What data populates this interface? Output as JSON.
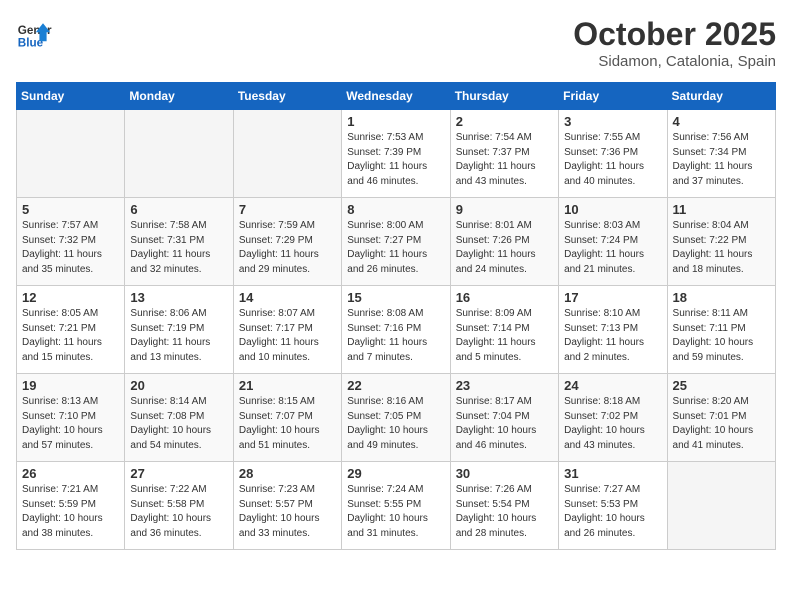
{
  "logo": {
    "line1": "General",
    "line2": "Blue"
  },
  "header": {
    "month": "October 2025",
    "location": "Sidamon, Catalonia, Spain"
  },
  "weekdays": [
    "Sunday",
    "Monday",
    "Tuesday",
    "Wednesday",
    "Thursday",
    "Friday",
    "Saturday"
  ],
  "weeks": [
    [
      {
        "day": "",
        "info": ""
      },
      {
        "day": "",
        "info": ""
      },
      {
        "day": "",
        "info": ""
      },
      {
        "day": "1",
        "info": "Sunrise: 7:53 AM\nSunset: 7:39 PM\nDaylight: 11 hours and 46 minutes."
      },
      {
        "day": "2",
        "info": "Sunrise: 7:54 AM\nSunset: 7:37 PM\nDaylight: 11 hours and 43 minutes."
      },
      {
        "day": "3",
        "info": "Sunrise: 7:55 AM\nSunset: 7:36 PM\nDaylight: 11 hours and 40 minutes."
      },
      {
        "day": "4",
        "info": "Sunrise: 7:56 AM\nSunset: 7:34 PM\nDaylight: 11 hours and 37 minutes."
      }
    ],
    [
      {
        "day": "5",
        "info": "Sunrise: 7:57 AM\nSunset: 7:32 PM\nDaylight: 11 hours and 35 minutes."
      },
      {
        "day": "6",
        "info": "Sunrise: 7:58 AM\nSunset: 7:31 PM\nDaylight: 11 hours and 32 minutes."
      },
      {
        "day": "7",
        "info": "Sunrise: 7:59 AM\nSunset: 7:29 PM\nDaylight: 11 hours and 29 minutes."
      },
      {
        "day": "8",
        "info": "Sunrise: 8:00 AM\nSunset: 7:27 PM\nDaylight: 11 hours and 26 minutes."
      },
      {
        "day": "9",
        "info": "Sunrise: 8:01 AM\nSunset: 7:26 PM\nDaylight: 11 hours and 24 minutes."
      },
      {
        "day": "10",
        "info": "Sunrise: 8:03 AM\nSunset: 7:24 PM\nDaylight: 11 hours and 21 minutes."
      },
      {
        "day": "11",
        "info": "Sunrise: 8:04 AM\nSunset: 7:22 PM\nDaylight: 11 hours and 18 minutes."
      }
    ],
    [
      {
        "day": "12",
        "info": "Sunrise: 8:05 AM\nSunset: 7:21 PM\nDaylight: 11 hours and 15 minutes."
      },
      {
        "day": "13",
        "info": "Sunrise: 8:06 AM\nSunset: 7:19 PM\nDaylight: 11 hours and 13 minutes."
      },
      {
        "day": "14",
        "info": "Sunrise: 8:07 AM\nSunset: 7:17 PM\nDaylight: 11 hours and 10 minutes."
      },
      {
        "day": "15",
        "info": "Sunrise: 8:08 AM\nSunset: 7:16 PM\nDaylight: 11 hours and 7 minutes."
      },
      {
        "day": "16",
        "info": "Sunrise: 8:09 AM\nSunset: 7:14 PM\nDaylight: 11 hours and 5 minutes."
      },
      {
        "day": "17",
        "info": "Sunrise: 8:10 AM\nSunset: 7:13 PM\nDaylight: 11 hours and 2 minutes."
      },
      {
        "day": "18",
        "info": "Sunrise: 8:11 AM\nSunset: 7:11 PM\nDaylight: 10 hours and 59 minutes."
      }
    ],
    [
      {
        "day": "19",
        "info": "Sunrise: 8:13 AM\nSunset: 7:10 PM\nDaylight: 10 hours and 57 minutes."
      },
      {
        "day": "20",
        "info": "Sunrise: 8:14 AM\nSunset: 7:08 PM\nDaylight: 10 hours and 54 minutes."
      },
      {
        "day": "21",
        "info": "Sunrise: 8:15 AM\nSunset: 7:07 PM\nDaylight: 10 hours and 51 minutes."
      },
      {
        "day": "22",
        "info": "Sunrise: 8:16 AM\nSunset: 7:05 PM\nDaylight: 10 hours and 49 minutes."
      },
      {
        "day": "23",
        "info": "Sunrise: 8:17 AM\nSunset: 7:04 PM\nDaylight: 10 hours and 46 minutes."
      },
      {
        "day": "24",
        "info": "Sunrise: 8:18 AM\nSunset: 7:02 PM\nDaylight: 10 hours and 43 minutes."
      },
      {
        "day": "25",
        "info": "Sunrise: 8:20 AM\nSunset: 7:01 PM\nDaylight: 10 hours and 41 minutes."
      }
    ],
    [
      {
        "day": "26",
        "info": "Sunrise: 7:21 AM\nSunset: 5:59 PM\nDaylight: 10 hours and 38 minutes."
      },
      {
        "day": "27",
        "info": "Sunrise: 7:22 AM\nSunset: 5:58 PM\nDaylight: 10 hours and 36 minutes."
      },
      {
        "day": "28",
        "info": "Sunrise: 7:23 AM\nSunset: 5:57 PM\nDaylight: 10 hours and 33 minutes."
      },
      {
        "day": "29",
        "info": "Sunrise: 7:24 AM\nSunset: 5:55 PM\nDaylight: 10 hours and 31 minutes."
      },
      {
        "day": "30",
        "info": "Sunrise: 7:26 AM\nSunset: 5:54 PM\nDaylight: 10 hours and 28 minutes."
      },
      {
        "day": "31",
        "info": "Sunrise: 7:27 AM\nSunset: 5:53 PM\nDaylight: 10 hours and 26 minutes."
      },
      {
        "day": "",
        "info": ""
      }
    ]
  ]
}
